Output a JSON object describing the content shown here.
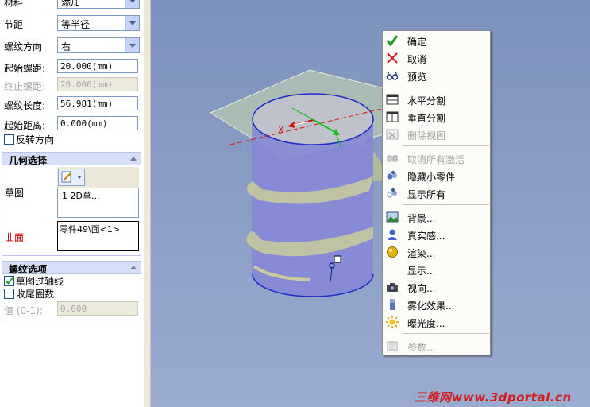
{
  "panel": {
    "material": {
      "label": "材料",
      "value": "添加"
    },
    "pitch": {
      "label": "节距",
      "value": "等半径"
    },
    "direction": {
      "label": "螺纹方向",
      "value": "右"
    },
    "start_pitch": {
      "label": "起始螺距:",
      "value": "20.000(mm)"
    },
    "end_pitch": {
      "label": "终止螺距:",
      "value": "20.000(mm)"
    },
    "length": {
      "label": "螺纹长度:",
      "value": "56.981(mm)"
    },
    "start_distance": {
      "label": "起始距离:",
      "value": "0.000(mm)"
    },
    "reverse": {
      "label": "反转方向",
      "checked": false
    },
    "geometry": {
      "title": "几何选择",
      "sketch_label": "草图",
      "sketch_item": "1  2D草...",
      "surface_label": "曲面",
      "surface_value": "零件49\\面<1>",
      "surface_color": "#c00000"
    },
    "options": {
      "title": "螺纹选项",
      "through_axis": {
        "label": "草图过轴线",
        "checked": true
      },
      "tail_turns": {
        "label": "收尾圈数",
        "checked": false
      },
      "value_label": "值 (0-1):",
      "value": "0.000"
    }
  },
  "viewport": {
    "bg_top": "#7c91bd",
    "bg_bottom": "#9aabcf",
    "axis_label": "X"
  },
  "context_menu": [
    {
      "icon": "checkmark-icon",
      "label": "确定",
      "enabled": true
    },
    {
      "icon": "cancel-x-icon",
      "label": "取消",
      "enabled": true
    },
    {
      "icon": "glasses-icon",
      "label": "预览",
      "enabled": true
    },
    {
      "icon": "horizontal-split-icon",
      "label": "水平分割",
      "enabled": true
    },
    {
      "icon": "vertical-split-icon",
      "label": "垂直分割",
      "enabled": true
    },
    {
      "icon": "delete-view-icon",
      "label": "删除视图",
      "enabled": false
    },
    {
      "icon": "deactivate-icon",
      "label": "取消所有激活",
      "enabled": false
    },
    {
      "icon": "hide-parts-icon",
      "label": "隐藏小零件",
      "enabled": true
    },
    {
      "icon": "show-all-icon",
      "label": "显示所有",
      "enabled": true
    },
    {
      "icon": "background-icon",
      "label": "背景...",
      "enabled": true
    },
    {
      "icon": "realism-icon",
      "label": "真实感...",
      "enabled": true
    },
    {
      "icon": "render-sphere-icon",
      "label": "渲染...",
      "enabled": true
    },
    {
      "icon": "display-icon",
      "label": "显示...",
      "enabled": true
    },
    {
      "icon": "camera-icon",
      "label": "视向...",
      "enabled": true
    },
    {
      "icon": "fog-icon",
      "label": "雾化效果...",
      "enabled": true
    },
    {
      "icon": "exposure-sun-icon",
      "label": "曝光度...",
      "enabled": true
    },
    {
      "icon": "parameters-icon",
      "label": "参数...",
      "enabled": false
    }
  ],
  "watermark": "三维网www.3dportal.cn"
}
